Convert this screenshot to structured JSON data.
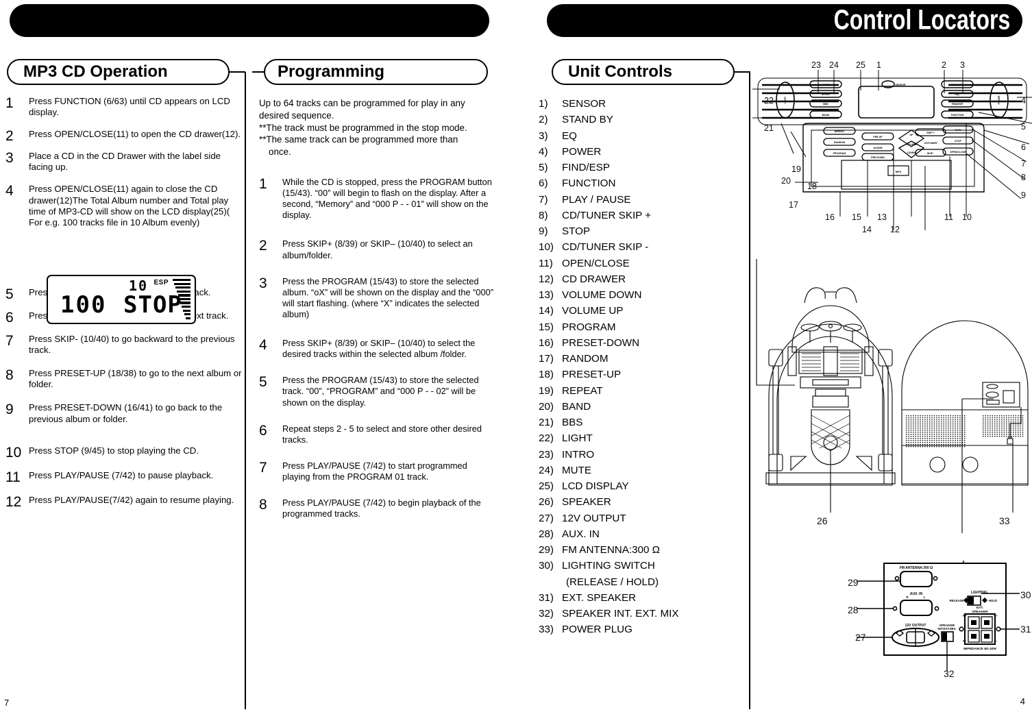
{
  "header": {
    "left_banner": "",
    "right_banner": "Control Locators"
  },
  "sections": {
    "mp3": {
      "title": "MP3 CD Operation"
    },
    "programming": {
      "title": "Programming"
    },
    "unit_controls": {
      "title": "Unit Controls"
    }
  },
  "mp3_steps": [
    {
      "num": "1",
      "text": "Press FUNCTION (6/63) until CD appears on LCD display."
    },
    {
      "num": "2",
      "text": "Press OPEN/CLOSE(11) to open the CD drawer(12)."
    },
    {
      "num": "3",
      "text": "Place a CD in the CD Drawer with the label side facing up."
    },
    {
      "num": "4",
      "text": "Press OPEN/CLOSE(11) again to close the CD drawer(12)The Total Album number and Total play time of MP3-CD will show on the LCD display(25)( For e.g. 100 tracks file in 10 Album evenly)"
    },
    {
      "num": "5",
      "text": "Press PLAY/PAUSE (7/42) to begin playback."
    },
    {
      "num": "6",
      "text": "Press SKIP+(8/39) to go forward to the next track."
    },
    {
      "num": "7",
      "text": "Press SKIP- (10/40) to go backward to the previous track."
    },
    {
      "num": "8",
      "text": "Press PRESET-UP (18/38) to go to the next album or folder."
    },
    {
      "num": "9",
      "text": "Press PRESET-DOWN (16/41) to go back to the previous album or folder."
    },
    {
      "num": "10",
      "text": "Press STOP (9/45) to stop playing the CD."
    },
    {
      "num": "11",
      "text": "Press PLAY/PAUSE (7/42) to pause playback."
    },
    {
      "num": "12",
      "text": "Press PLAY/PAUSE(7/42) again to resume playing."
    }
  ],
  "lcd_display": {
    "album_count": "10",
    "track_count": "100",
    "status": "STOP",
    "esp_label": "ESP",
    "bar_levels": 11
  },
  "programming_intro": {
    "line1": "Up to 64 tracks can be programmed for play in any desired sequence.",
    "line2": "**The track must be programmed in the stop mode.",
    "line3": "**The same track can be programmed more than",
    "line4": "once."
  },
  "programming_steps": [
    {
      "num": "1",
      "text": "While the CD is stopped, press the PROGRAM button (15/43). “00” will begin to flash on the display. After a second, “Memory” and “000 P - - 01” will show on the display."
    },
    {
      "num": "2",
      "text": "Press SKIP+ (8/39) or SKIP– (10/40) to select an album/folder."
    },
    {
      "num": "3",
      "text": "Press the PROGRAM (15/43) to store the selected album. “oX” will be shown on the display and the “000” will start flashing. (where “X” indicates the selected album)"
    },
    {
      "num": "4",
      "text": "Press SKIP+ (8/39) or SKIP– (10/40) to select the desired tracks within the selected album /folder."
    },
    {
      "num": "5",
      "text": "Press the PROGRAM (15/43) to store the selected track. “00”, “PROGRAM” and “000 P - - 02” will be shown on the display."
    },
    {
      "num": "6",
      "text": "Repeat steps 2 - 5 to select and store other desired tracks."
    },
    {
      "num": "7",
      "text": "Press PLAY/PAUSE (7/42) to start programmed playing from the PROGRAM 01 track."
    },
    {
      "num": "8",
      "text": "Press PLAY/PAUSE (7/42) to begin playback of the programmed tracks."
    }
  ],
  "unit_controls": [
    {
      "index": "1)",
      "label": "SENSOR"
    },
    {
      "index": "2)",
      "label": "STAND BY"
    },
    {
      "index": "3)",
      "label": "EQ"
    },
    {
      "index": "4)",
      "label": "POWER"
    },
    {
      "index": "5)",
      "label": "FIND/ESP"
    },
    {
      "index": "6)",
      "label": "FUNCTION"
    },
    {
      "index": "7)",
      "label": "PLAY / PAUSE"
    },
    {
      "index": "8)",
      "label": "CD/TUNER SKIP +"
    },
    {
      "index": "9)",
      "label": "STOP"
    },
    {
      "index": "10)",
      "label": "CD/TUNER SKIP -"
    },
    {
      "index": "11)",
      "label": "OPEN/CLOSE"
    },
    {
      "index": "12)",
      "label": "CD DRAWER"
    },
    {
      "index": "13)",
      "label": "VOLUME DOWN"
    },
    {
      "index": "14)",
      "label": "VOLUME UP"
    },
    {
      "index": "15)",
      "label": "PROGRAM"
    },
    {
      "index": "16)",
      "label": "PRESET-DOWN"
    },
    {
      "index": "17)",
      "label": "RANDOM"
    },
    {
      "index": "18)",
      "label": "PRESET-UP"
    },
    {
      "index": "19)",
      "label": "REPEAT"
    },
    {
      "index": "20)",
      "label": "BAND"
    },
    {
      "index": "21)",
      "label": "BBS"
    },
    {
      "index": "22)",
      "label": "LIGHT"
    },
    {
      "index": "23)",
      "label": "INTRO"
    },
    {
      "index": "24)",
      "label": "MUTE"
    },
    {
      "index": "25)",
      "label": "LCD DISPLAY"
    },
    {
      "index": "26)",
      "label": "SPEAKER"
    },
    {
      "index": "27)",
      "label": "12V OUTPUT"
    },
    {
      "index": "28)",
      "label": "AUX. IN"
    },
    {
      "index": "29)",
      "label": "FM ANTENNA:300 Ω"
    },
    {
      "index": "30)",
      "label": "LIGHTING SWITCH",
      "sub": "(RELEASE / HOLD)"
    },
    {
      "index": "31)",
      "label": "EXT. SPEAKER"
    },
    {
      "index": "32)",
      "label": "SPEAKER INT. EXT. MIX"
    },
    {
      "index": "33)",
      "label": "POWER PLUG"
    }
  ],
  "panel_diagram": {
    "callouts_top": [
      "23",
      "24",
      "25",
      "1",
      "2",
      "3"
    ],
    "callouts_right": [
      "4",
      "5",
      "6",
      "7",
      "8",
      "9"
    ],
    "callouts_left": [
      "22",
      "21",
      "19",
      "20",
      "18",
      "17"
    ],
    "callouts_bottom": [
      "16",
      "15",
      "14",
      "12",
      "13",
      "11",
      "10"
    ],
    "buttons_top_left": [
      "MUTE",
      "INTRO",
      "BBS",
      "BAND"
    ],
    "buttons_top_right": [
      "STAND BY",
      "EQ",
      "FIND/ESP",
      "FUNCTION"
    ],
    "side_button_left": "LIGHT",
    "side_button_right": "POWER",
    "sensor_label": "SENSOR",
    "buttons_lower_left": [
      "REPEAT",
      "RANDOM",
      "PROGRAM"
    ],
    "buttons_lower_mid": [
      "PRE.UP",
      "ALBUM",
      "PRE.DOWN"
    ],
    "volume_labels": [
      "UP",
      "VOLUME",
      "DOWN"
    ],
    "buttons_lower_right": [
      "SKIP +",
      "CD/TUNER",
      "SKIP -"
    ],
    "buttons_far_right": [
      "PLAY",
      "STOP",
      "OPEN/CLOSE"
    ],
    "drawer_logo": "MP3"
  },
  "unit_diagram": {
    "front_callout": "26",
    "rear_callout": "33"
  },
  "back_panel": {
    "fm_antenna": "FM ANTENNA:300 Ω",
    "aux_in": "AUX. IN",
    "aux_r": "R",
    "aux_l": "L",
    "output_12v": "12V OUTPUT",
    "speaker_mix": "SPEAKER",
    "speaker_mix2": "INT.EXT.MIX.",
    "lighting": "LIGHTING",
    "release": "RELEASE",
    "hold": "HOLD",
    "ext_speaker": "EXT.",
    "ext_speaker2": "SPEAKER",
    "term_rp": "R+",
    "term_lp": "L+",
    "term_rm": "R–",
    "term_lm": "L–",
    "impedance": "IMPEDANCE 8Ω 40W",
    "callouts": [
      "29",
      "28",
      "27",
      "30",
      "31",
      "32"
    ]
  },
  "page_numbers": {
    "left": "7",
    "right": "4"
  },
  "colors": {
    "ink": "#000000",
    "paper": "#ffffff"
  }
}
